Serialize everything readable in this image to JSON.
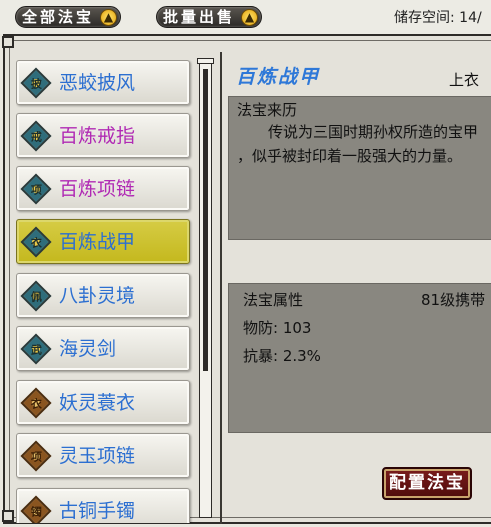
{
  "tabs": {
    "all_treasures": "全部法宝",
    "bulk_sell": "批量出售"
  },
  "storage": "储存空间: 14/",
  "items": [
    {
      "name": "恶蛟披风",
      "badge": "披",
      "name_color": "#2c6fd1",
      "icon_style": "teal",
      "selected": false
    },
    {
      "name": "百炼戒指",
      "badge": "戒",
      "name_color": "#b02ab4",
      "icon_style": "teal",
      "selected": false
    },
    {
      "name": "百炼项链",
      "badge": "项",
      "name_color": "#b02ab4",
      "icon_style": "teal",
      "selected": false
    },
    {
      "name": "百炼战甲",
      "badge": "衣",
      "name_color": "#2c6fd1",
      "icon_style": "teal",
      "selected": true
    },
    {
      "name": "八卦灵境",
      "badge": "佩",
      "name_color": "#2c6fd1",
      "icon_style": "teal",
      "selected": false
    },
    {
      "name": "海灵剑",
      "badge": "武",
      "name_color": "#2c6fd1",
      "icon_style": "teal",
      "selected": false
    },
    {
      "name": "妖灵蓑衣",
      "badge": "衣",
      "name_color": "#2c6fd1",
      "icon_style": "brown",
      "selected": false
    },
    {
      "name": "灵玉项链",
      "badge": "项",
      "name_color": "#2c6fd1",
      "icon_style": "brown",
      "selected": false
    },
    {
      "name": "古铜手镯",
      "badge": "镯",
      "name_color": "#2c6fd1",
      "icon_style": "brown",
      "selected": false
    }
  ],
  "detail": {
    "title": "百炼战甲",
    "slot": "上衣",
    "history_label": "法宝来历",
    "history_line1": "传说为三国时期孙权所造的宝甲",
    "history_line2": "，似乎被封印着一股强大的力量。",
    "attr_label": "法宝属性",
    "level_req": "81级携带",
    "stat_def": "物防: 103",
    "stat_crit": "抗暴: 2.3%"
  },
  "configure_button": "配置法宝",
  "colors": {
    "title_blue": "#2e78d8",
    "selected_item_bg": "#cfc431",
    "button_red": "#6b1515",
    "panel_gray": "#898780"
  }
}
